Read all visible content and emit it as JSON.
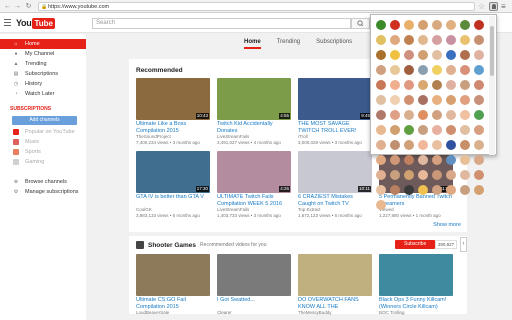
{
  "browser": {
    "url": "https://www.youtube.com",
    "back": "←",
    "forward": "→",
    "reload": "↻",
    "star": "☆",
    "menu": "≡"
  },
  "header": {
    "logo_you": "You",
    "logo_tube": "Tube",
    "search_placeholder": "Search"
  },
  "sidebar": {
    "items": [
      {
        "label": "Home",
        "icon": "home-icon"
      },
      {
        "label": "My Channel",
        "icon": "user-icon"
      },
      {
        "label": "Trending",
        "icon": "flame-icon"
      },
      {
        "label": "Subscriptions",
        "icon": "subscriptions-icon"
      },
      {
        "label": "History",
        "icon": "history-icon"
      },
      {
        "label": "Watch Later",
        "icon": "clock-icon"
      }
    ],
    "subs_title": "SUBSCRIPTIONS",
    "add_channels": "Add channels",
    "channels": [
      "Popular on YouTube",
      "Music",
      "Sports",
      "Gaming"
    ],
    "footer": [
      "Browse channels",
      "Manage subscriptions"
    ]
  },
  "tabs": [
    "Home",
    "Trending",
    "Subscriptions"
  ],
  "recommended": {
    "title": "Recommended",
    "show_more": "Show more",
    "videos": [
      {
        "title": "Ultimate Like a Boss Compilation 2015",
        "channel": "TheSoundProject",
        "meta": "7,400,234 views • 3 months ago",
        "duration": "10:43",
        "color": "#8a6a3e"
      },
      {
        "title": "Twitch Kid Accidentally Donates",
        "channel": "LiveStreamFails",
        "meta": "3,491,027 views • 4 months ago",
        "duration": "4:55",
        "color": "#7c9c4a"
      },
      {
        "title": "THE MOST SAVAGE TWITCH TROLL EVER! PULLS OUT ...",
        "channel": "iTroll",
        "meta": "3,000,028 views • 3 months ago",
        "duration": "9:45",
        "color": "#3c5a8c"
      },
      {
        "title": "",
        "channel": "",
        "meta": "",
        "duration": "",
        "color": "#9a9a9a"
      },
      {
        "title": "GTA IV is better than GTA V",
        "channel": "CoolGK",
        "meta": "3,883,133 views • 6 months ago",
        "duration": "17:30",
        "color": "#3f6e8e"
      },
      {
        "title": "ULTIMATE Twitch Fails Compilation WEEK 5 2016",
        "channel": "LiveStreamFails",
        "meta": "1,403,733 views • 3 months ago",
        "duration": "4:26",
        "color": "#b48ca0"
      },
      {
        "title": "6 CRAZIEST Mistakes Caught on Twitch TV",
        "channel": "Top Extract",
        "meta": "1,672,123 views • 6 months ago",
        "duration": "10:11",
        "color": "#c8c8d2"
      },
      {
        "title": "5 Permanently Banned Twitch Streamers",
        "channel": "Viewed",
        "meta": "1,227,880 views • 1 month ago",
        "duration": "11:00",
        "color": "#6e5a5a"
      }
    ]
  },
  "shooter": {
    "title": "Shooter Games",
    "subtitle": "Recommended videos for you",
    "subscribe": "Subscribe",
    "subs_count": "390,927",
    "videos": [
      {
        "title": "Ultimate CS:GO Fail Compilation 2015",
        "channel": "LoudBeaverSale",
        "color": "#8c7a5a"
      },
      {
        "title": "I Got Swatted...",
        "channel": "Clearer",
        "color": "#7a7a7a"
      },
      {
        "title": "DO OVERWATCH FANS KNOW ALL THE OVERWATCH",
        "channel": "TheMessyBuddy",
        "color": "#c0b080"
      },
      {
        "title": "Black Ops 3 Funny Killcam! (Winners Circle Killcam)",
        "channel": "BOC Trolling",
        "color": "#3f8a9e"
      }
    ]
  },
  "popup": {
    "face_colors": [
      "#3a8a2a",
      "#d03020",
      "#e8b068",
      "#d4a070",
      "#d8a880",
      "#e0b080",
      "#5a8a3a",
      "#c03020",
      "#e0c060",
      "#e0a880",
      "#c08050",
      "#e0b890",
      "#d4a0a0",
      "#c890a0",
      "#e8c070",
      "#c89070",
      "#a8702a",
      "#f0c040",
      "#d09080",
      "#d0a070",
      "#e0c0a0",
      "#3a70c0",
      "#b07050",
      "#e0b0a0",
      "#d0a080",
      "#e8c898",
      "#a06040",
      "#8aa0b0",
      "#f0d060",
      "#e0b090",
      "#d89078",
      "#60a0d0",
      "#c87858",
      "#f0b090",
      "#e09880",
      "#d8a870",
      "#b08050",
      "#e0b0a0",
      "#c8a080",
      "#d08870",
      "#e0c0a0",
      "#f0d0b0",
      "#d09070",
      "#a87060",
      "#e8b080",
      "#d8a070",
      "#e0a080",
      "#c89078",
      "#b07868",
      "#e0a088",
      "#d8b090",
      "#e09060",
      "#d0a080",
      "#e0b8a0",
      "#f0c0a0",
      "#50a050",
      "#e8b890",
      "#d0a070",
      "#60a040",
      "#c8a080",
      "#e8b0a0",
      "#d09070",
      "#e0c0a0",
      "#d8a080",
      "#e0b090",
      "#c09070",
      "#d0a078",
      "#f0b898",
      "#e8c0a0",
      "#3050a0",
      "#c89068",
      "#d8b090",
      "#e0a880",
      "#d09878",
      "#c08060",
      "#e0b8a0",
      "#d4a080",
      "#6090c0",
      "#e8c098",
      "#d8a888",
      "#e0b090",
      "#c8a080",
      "#d0a070",
      "#e8b898",
      "#c89878",
      "#d8a888",
      "#e0b8a0",
      "#d09070",
      "#e8c0a0",
      "#b88060",
      "#3a3a3a",
      "#f0c050",
      "#d0a080",
      "#e0a880",
      "#c8a080",
      "#d4a070",
      "#e8b890"
    ]
  }
}
